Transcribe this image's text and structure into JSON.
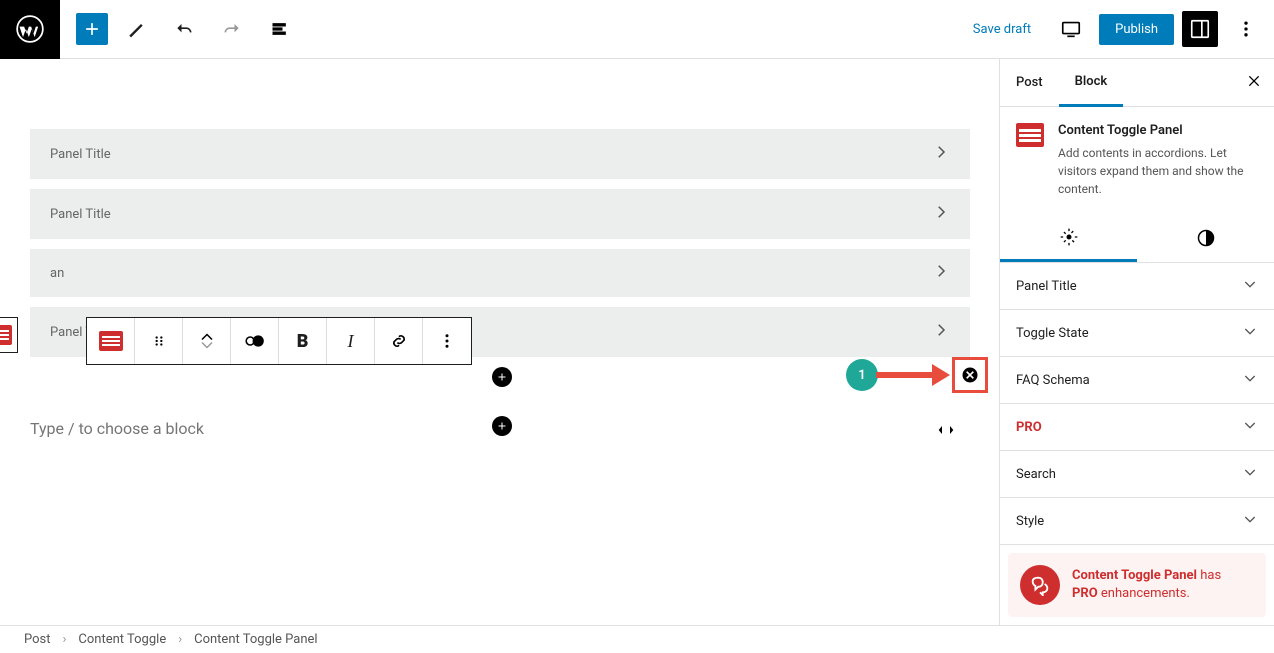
{
  "header": {
    "save_draft": "Save draft",
    "publish": "Publish"
  },
  "editor": {
    "panels": [
      "Panel Title",
      "Panel Title",
      "an",
      "Panel Title"
    ],
    "prompt": "Type / to choose a block"
  },
  "annotation": {
    "number": "1"
  },
  "sidebar": {
    "tabs": {
      "post": "Post",
      "block": "Block"
    },
    "block_card": {
      "title": "Content Toggle Panel",
      "desc": "Add contents in accordions. Let visitors expand them and show the content."
    },
    "settings": {
      "panel_title": "Panel Title",
      "toggle_state": "Toggle State",
      "faq_schema": "FAQ Schema",
      "pro": "PRO",
      "search": "Search",
      "style": "Style"
    },
    "promo": {
      "line1a": "Content Toggle Panel",
      "line1b": " has ",
      "line2a": "PRO",
      "line2b": " enhancements."
    }
  },
  "breadcrumb": {
    "a": "Post",
    "b": "Content Toggle",
    "c": "Content Toggle Panel"
  }
}
